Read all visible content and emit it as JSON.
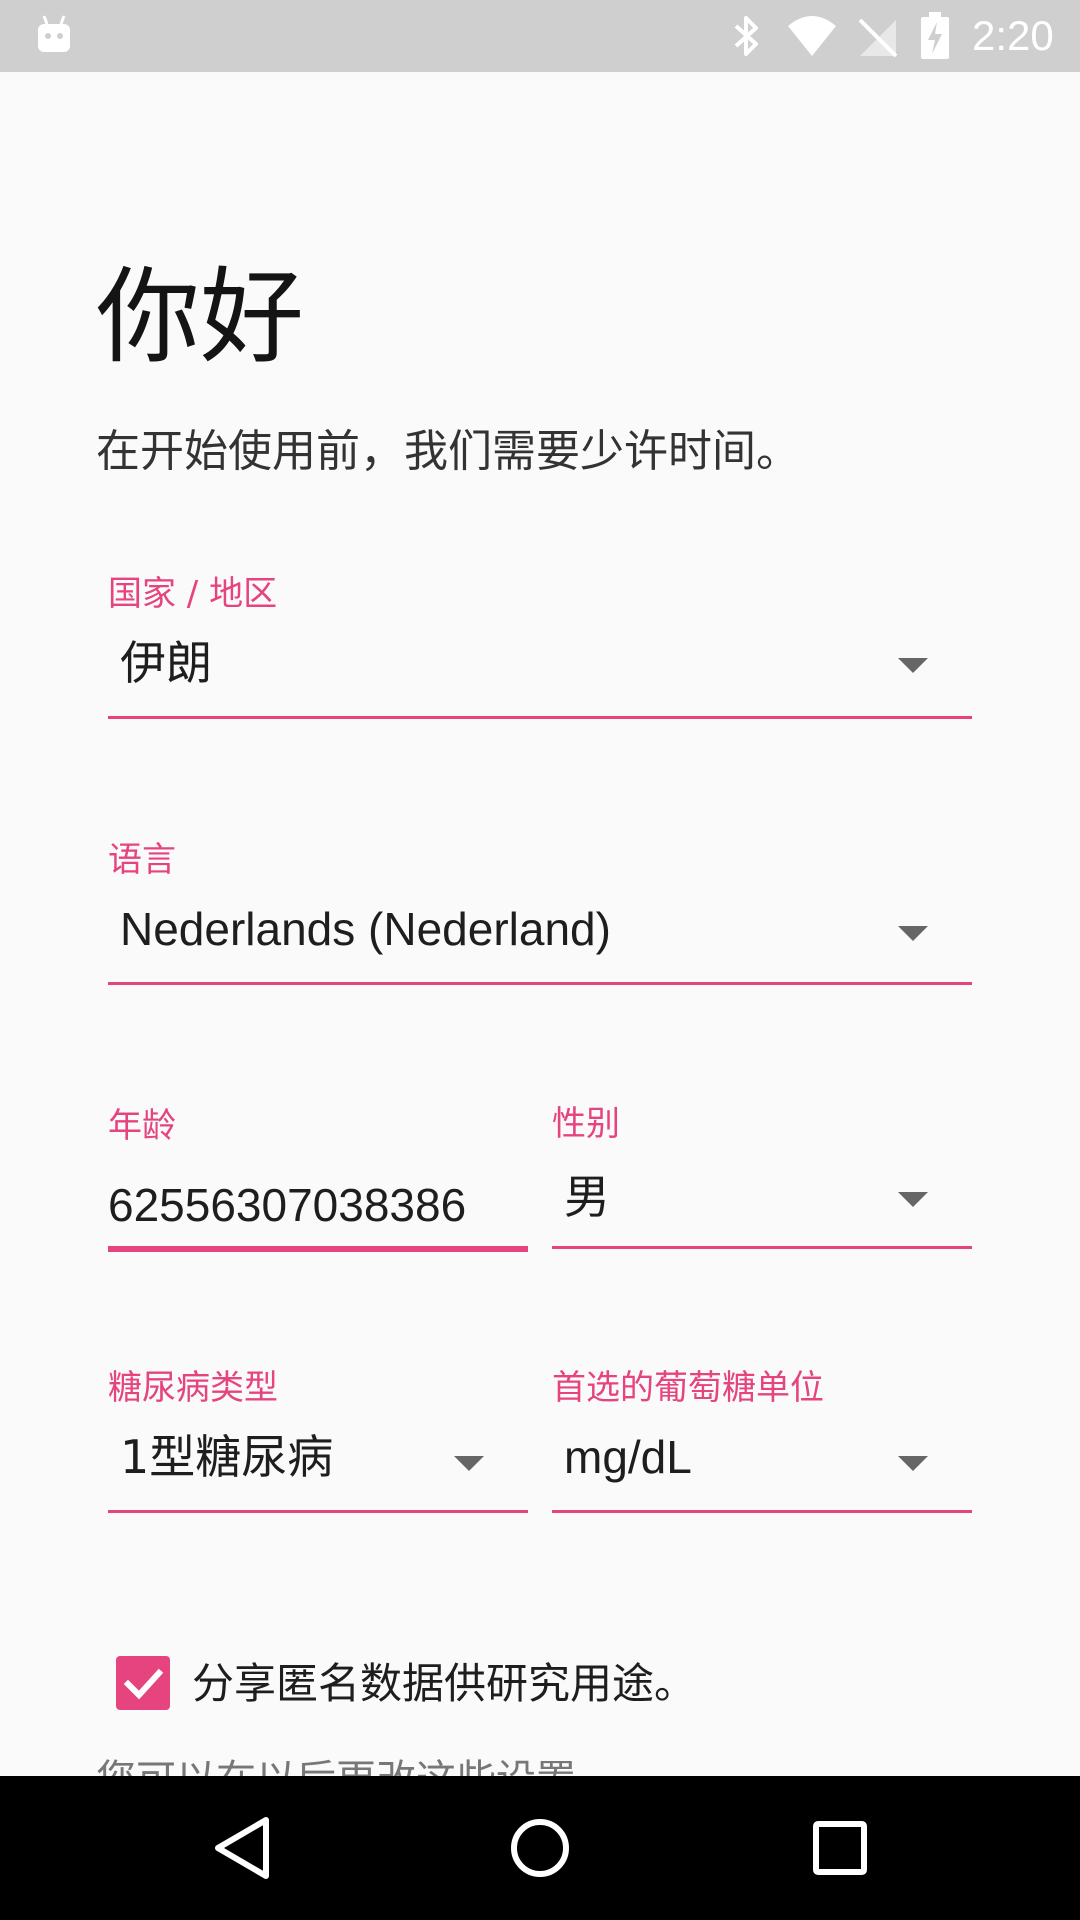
{
  "status_bar": {
    "time": "2:20",
    "icons": [
      "android-debug-icon",
      "bluetooth-icon",
      "wifi-icon",
      "no-signal-icon",
      "battery-charging-icon"
    ]
  },
  "header": {
    "title": "你好",
    "subtitle": "在开始使用前，我们需要少许时间。"
  },
  "form": {
    "country": {
      "label": "国家 / 地区",
      "value": "伊朗"
    },
    "language": {
      "label": "语言",
      "value": "Nederlands (Nederland)"
    },
    "age": {
      "label": "年龄",
      "value": "62556307038386"
    },
    "gender": {
      "label": "性别",
      "value": "男"
    },
    "diabetes_type": {
      "label": "糖尿病类型",
      "value": "1型糖尿病"
    },
    "glucose_unit": {
      "label": "首选的葡萄糖单位",
      "value": "mg/dL"
    },
    "share_data": {
      "label": "分享匿名数据供研究用途。",
      "checked": true
    },
    "footnote": "您可以在以后更改这些设置。"
  },
  "colors": {
    "accent": "#e5447f",
    "background": "#fafafa",
    "status_bar": "#cfcfcf",
    "nav_bar": "#000000"
  },
  "nav_bar": {
    "buttons": [
      "back-icon",
      "home-icon",
      "recents-icon"
    ]
  }
}
